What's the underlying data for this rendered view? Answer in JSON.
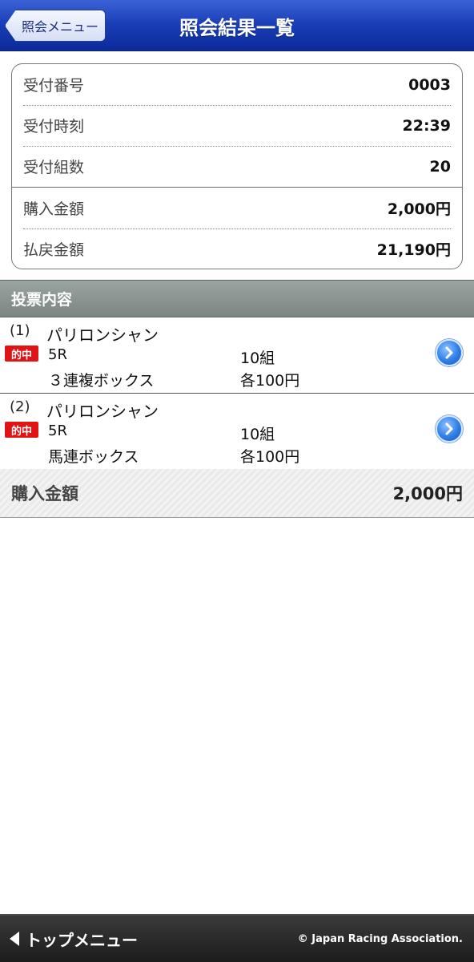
{
  "header": {
    "back_label": "照会メニュー",
    "title": "照会結果一覧"
  },
  "summary": {
    "rows": [
      {
        "label": "受付番号",
        "value": "0003"
      },
      {
        "label": "受付時刻",
        "value": "22:39"
      },
      {
        "label": "受付組数",
        "value": "20"
      },
      {
        "label": "購入金額",
        "value": "2,000円"
      },
      {
        "label": "払戻金額",
        "value": "21,190円"
      }
    ]
  },
  "section": {
    "title": "投票内容"
  },
  "bets": [
    {
      "number": "(1)",
      "venue": "パリロンシャン",
      "badge": "的中",
      "race": "5R",
      "type": "３連複ボックス",
      "combos": "10組",
      "each": "各100円"
    },
    {
      "number": "(2)",
      "venue": "パリロンシャン",
      "badge": "的中",
      "race": "5R",
      "type": "馬連ボックス",
      "combos": "10組",
      "each": "各100円"
    }
  ],
  "total": {
    "label": "購入金額",
    "value": "2,000円"
  },
  "footer": {
    "top_menu_label": "トップメニュー",
    "copyright": "© Japan Racing Association."
  },
  "colors": {
    "header_blue": "#1b3fb8",
    "badge_red": "#e01414",
    "section_gray": "#8a9490",
    "footer_dark": "#2a2a2a"
  },
  "icons": {
    "detail": "chevron-right-circle-icon",
    "back": "back-arrow-icon",
    "top_menu": "triangle-left-icon"
  }
}
